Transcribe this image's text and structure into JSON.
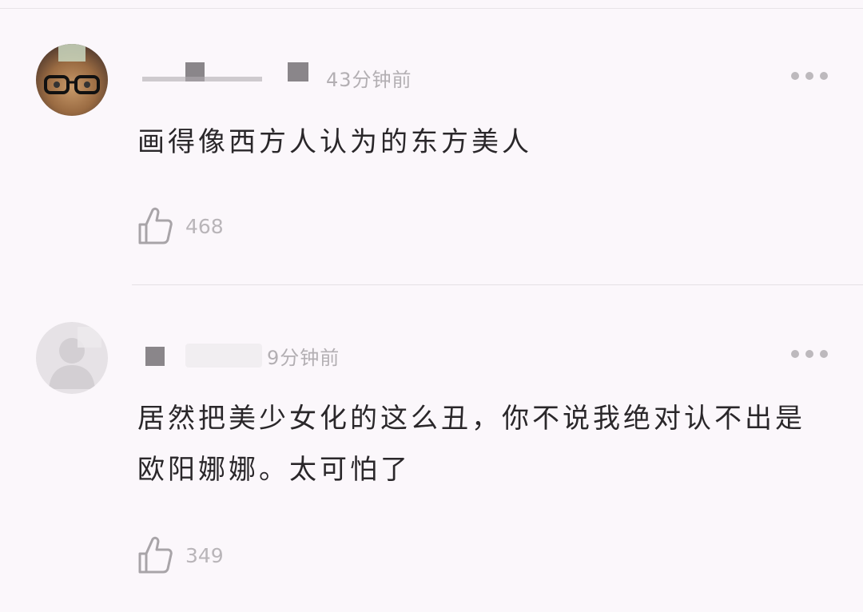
{
  "comments": [
    {
      "username": "",
      "time": "43分钟前",
      "text": "画得像西方人认为的东方美人",
      "likes": "468",
      "avatar": "cat-with-glasses"
    },
    {
      "username": "",
      "time": "9分钟前",
      "text": "居然把美少女化的这么丑，你不说我绝对认不出是欧阳娜娜。太可怕了",
      "likes": "349",
      "avatar": "default-person"
    }
  ],
  "icons": {
    "like": "thumbs-up-icon",
    "more": "more-dots-icon"
  },
  "colors": {
    "background": "#fbf7fb",
    "text": "#2a272a",
    "meta": "#b3afb3"
  }
}
